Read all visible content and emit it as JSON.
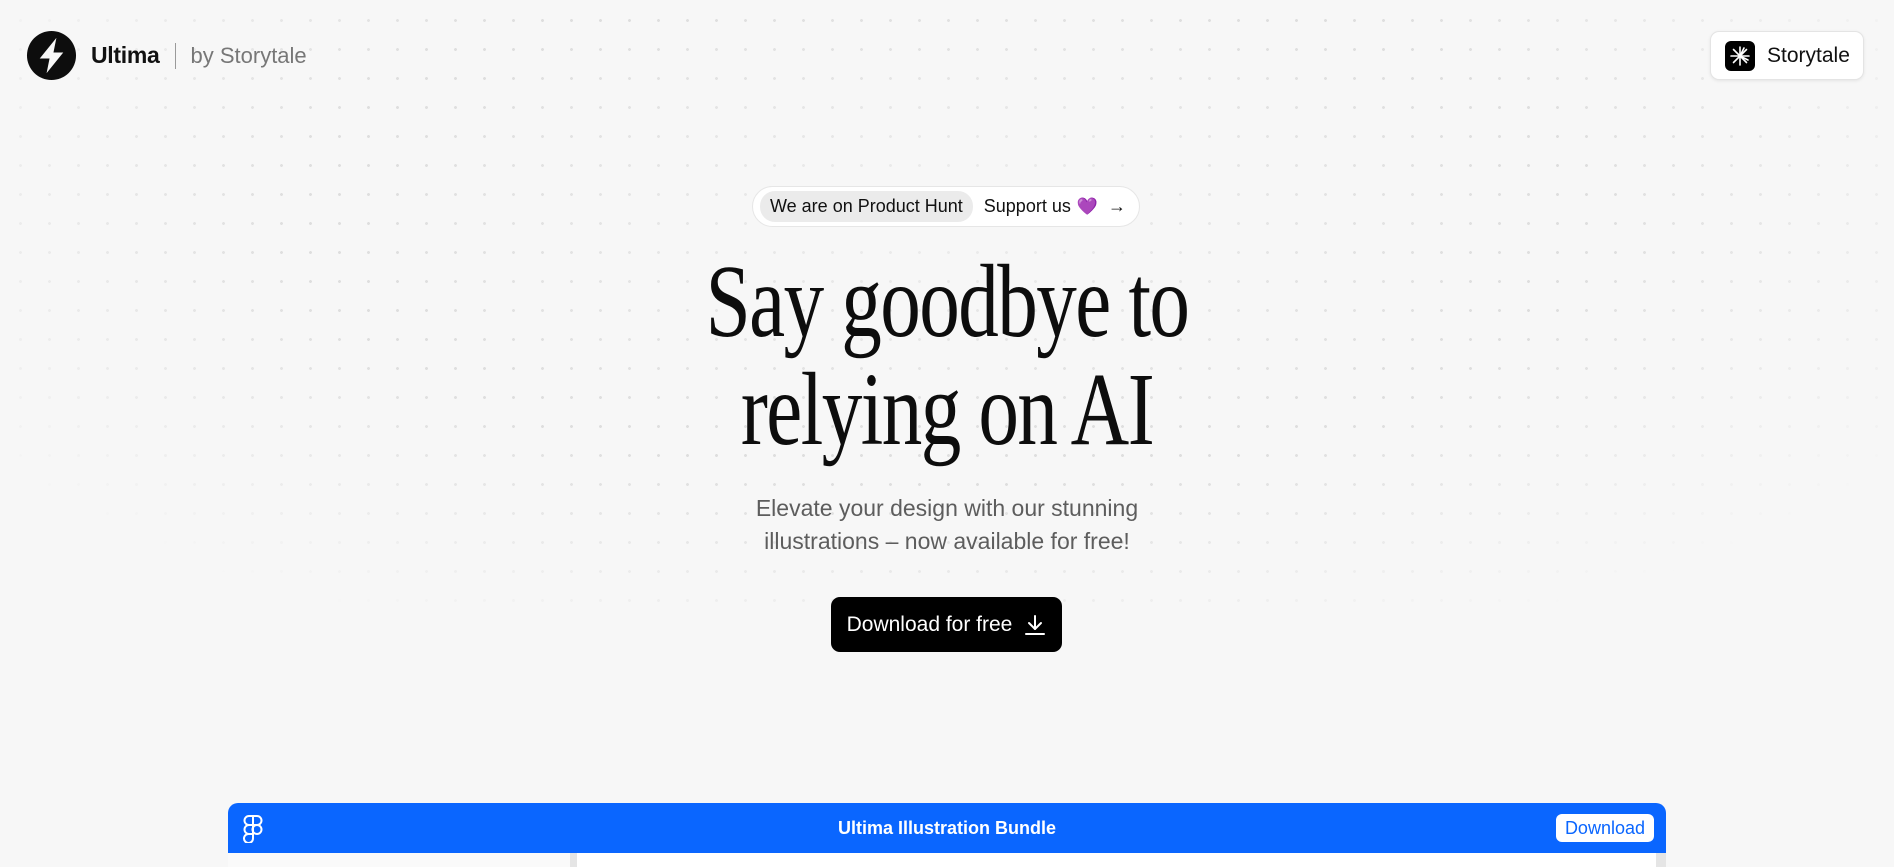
{
  "header": {
    "brand": "Ultima",
    "byline": "by Storytale",
    "storytale_button": "Storytale"
  },
  "announcement": {
    "pill": "We are on Product Hunt",
    "support": "Support us",
    "heart": "💜",
    "arrow": "→"
  },
  "hero": {
    "headline_line1": "Say goodbye to",
    "headline_line2": "relying on AI",
    "subtitle_line1": "Elevate your design with our stunning",
    "subtitle_line2": "illustrations – now available for free!",
    "cta_label": "Download for free"
  },
  "app_preview": {
    "title": "Ultima Illustration Bundle",
    "download_label": "Download",
    "accent": "#0a66ff"
  },
  "icons": [
    "ultima-logo-icon",
    "storytale-icon",
    "arrow-right-icon",
    "download-icon",
    "figma-icon"
  ]
}
